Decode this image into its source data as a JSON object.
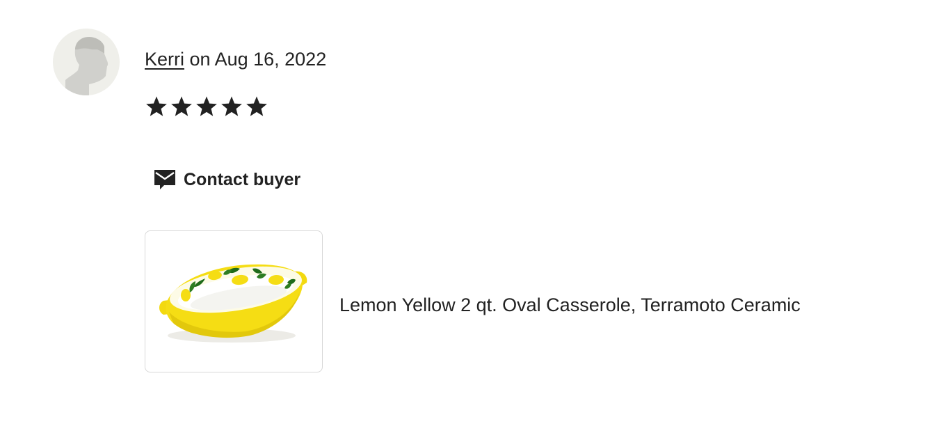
{
  "review": {
    "reviewer_name": "Kerri",
    "date_text": "on Aug 16, 2022",
    "rating": 5,
    "rating_max": 5,
    "avatar_icon": "default-user-silhouette-icon"
  },
  "actions": {
    "contact_label": "Contact buyer",
    "contact_icon": "envelope-message-icon"
  },
  "product": {
    "title": "Lemon Yellow 2 qt. Oval Casserole, Terramoto Ceramic",
    "image_desc_icon": "product-thumbnail"
  },
  "colors": {
    "text": "#222222",
    "star": "#222222",
    "avatar_bg": "#efefea",
    "avatar_silhouette": "#d0d0cc",
    "dish_yellow": "#f5dd14",
    "leaf_green": "#1f6b1a"
  }
}
